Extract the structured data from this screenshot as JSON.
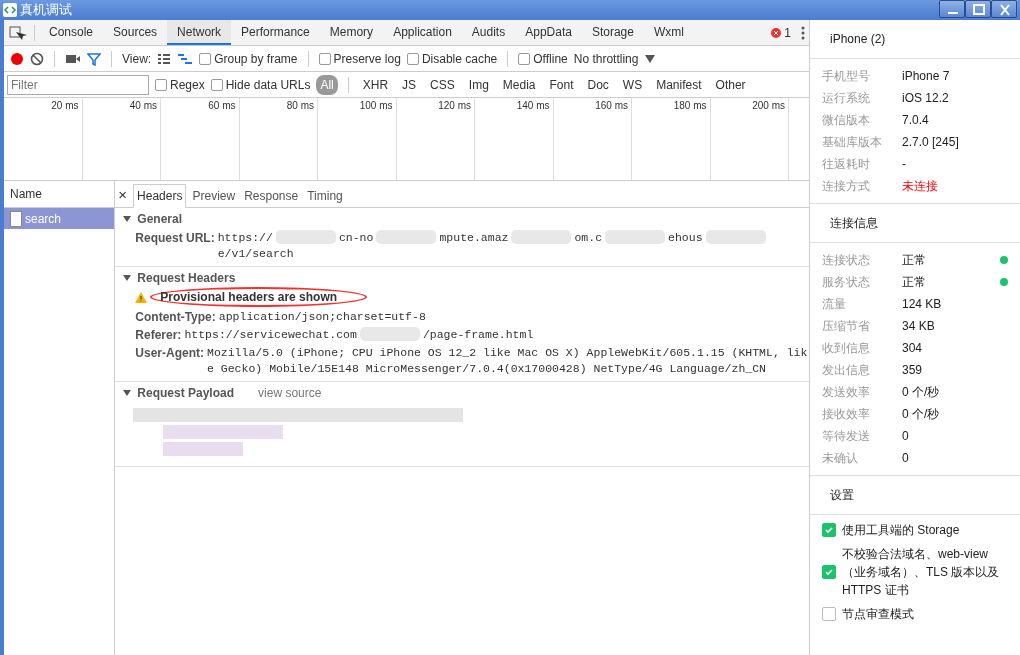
{
  "window": {
    "title": "真机调试"
  },
  "tabs": [
    {
      "label": "Console",
      "selected": false
    },
    {
      "label": "Sources",
      "selected": false
    },
    {
      "label": "Network",
      "selected": true
    },
    {
      "label": "Performance",
      "selected": false
    },
    {
      "label": "Memory",
      "selected": false
    },
    {
      "label": "Application",
      "selected": false
    },
    {
      "label": "Audits",
      "selected": false
    },
    {
      "label": "AppData",
      "selected": false
    },
    {
      "label": "Storage",
      "selected": false
    },
    {
      "label": "Wxml",
      "selected": false
    }
  ],
  "error_count": "1",
  "toolbar": {
    "recording": true,
    "view_label": "View:",
    "large_rows": false,
    "overview": true,
    "checkboxes": [
      {
        "label": "Group by frame",
        "checked": false
      },
      {
        "label": "Preserve log",
        "checked": false
      },
      {
        "label": "Disable cache",
        "checked": false
      },
      {
        "label": "Offline",
        "checked": false
      }
    ],
    "throttling": "No throttling"
  },
  "filter": {
    "placeholder": "Filter",
    "checkboxes": [
      {
        "label": "Regex",
        "checked": false
      },
      {
        "label": "Hide data URLs",
        "checked": false
      }
    ],
    "types": [
      {
        "label": "All",
        "selected": true
      },
      {
        "label": "XHR",
        "selected": false
      },
      {
        "label": "JS",
        "selected": false
      },
      {
        "label": "CSS",
        "selected": false
      },
      {
        "label": "Img",
        "selected": false
      },
      {
        "label": "Media",
        "selected": false
      },
      {
        "label": "Font",
        "selected": false
      },
      {
        "label": "Doc",
        "selected": false
      },
      {
        "label": "WS",
        "selected": false
      },
      {
        "label": "Manifest",
        "selected": false
      },
      {
        "label": "Other",
        "selected": false
      }
    ]
  },
  "timeline": {
    "ticks": [
      "20 ms",
      "40 ms",
      "60 ms",
      "80 ms",
      "100 ms",
      "120 ms",
      "140 ms",
      "160 ms",
      "180 ms",
      "200 ms"
    ]
  },
  "requests": {
    "column": "Name",
    "rows": [
      {
        "name": "search",
        "selected": true
      }
    ]
  },
  "detail_tabs": [
    {
      "label": "Headers",
      "selected": true
    },
    {
      "label": "Preview",
      "selected": false
    },
    {
      "label": "Response",
      "selected": false
    },
    {
      "label": "Timing",
      "selected": false
    }
  ],
  "sections": [
    {
      "title": "General",
      "fields": [
        {
          "key": "Request URL:",
          "parts": [
            "https://",
            "cn-no",
            "mpute.amaz",
            "om.c",
            "ehous",
            "e/v1/search"
          ]
        }
      ]
    },
    {
      "title": "Request Headers",
      "warning": "Provisional headers are shown",
      "fields": [
        {
          "key": "Content-Type:",
          "parts": [
            "application/json;charset=utf-8"
          ]
        },
        {
          "key": "Referer:",
          "parts": [
            "https://servicewechat.com",
            "/page-frame.html"
          ]
        },
        {
          "key": "User-Agent:",
          "parts": [
            "Mozilla/5.0 (iPhone; CPU iPhone OS 12_2 like Mac OS X) AppleWebKit/605.1.15 (KHTML, like Gecko) Mobile/15E148 MicroMessenger/7.0.4(0x17000428) NetType/4G Language/zh_CN"
          ]
        }
      ]
    },
    {
      "title": "Request Payload",
      "link": "view source"
    }
  ],
  "close_label": "×",
  "device": {
    "title": "iPhone (2)",
    "rows": [
      {
        "label": "手机型号",
        "value": "iPhone 7",
        "alert": false
      },
      {
        "label": "运行系统",
        "value": "iOS 12.2",
        "alert": false
      },
      {
        "label": "微信版本",
        "value": "7.0.4",
        "alert": false
      },
      {
        "label": "基础库版本",
        "value": "2.7.0 [245]",
        "alert": false
      },
      {
        "label": "往返耗时",
        "value": "-",
        "alert": false
      },
      {
        "label": "连接方式",
        "value": "未连接",
        "alert": true
      }
    ]
  },
  "connection": {
    "title": "连接信息",
    "rows": [
      {
        "label": "连接状态",
        "value": "正常",
        "color": "#1bc46b"
      },
      {
        "label": "服务状态",
        "value": "正常",
        "color": "#1bc46b"
      },
      {
        "label": "流量",
        "value": "124 KB"
      },
      {
        "label": "压缩节省",
        "value": "34 KB"
      },
      {
        "label": "收到信息",
        "value": "304"
      },
      {
        "label": "发出信息",
        "value": "359"
      },
      {
        "label": "发送效率",
        "value": "0 个/秒"
      },
      {
        "label": "接收效率",
        "value": "0 个/秒"
      },
      {
        "label": "等待发送",
        "value": "0"
      },
      {
        "label": "未确认",
        "value": "0"
      }
    ]
  },
  "settings": {
    "title": "设置",
    "options": [
      {
        "label": "使用工具端的 Storage",
        "checked": true
      },
      {
        "label": "不校验合法域名、web-view（业务域名）、TLS 版本以及 HTTPS 证书",
        "checked": true
      },
      {
        "label": "节点审查模式",
        "checked": false
      }
    ]
  }
}
